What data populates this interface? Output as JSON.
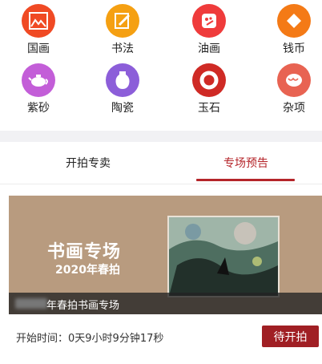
{
  "categories": [
    {
      "label": "国画",
      "icon": "landscape-painting-icon",
      "color": "#f04a24"
    },
    {
      "label": "书法",
      "icon": "calligraphy-brush-icon",
      "color": "#f5a012"
    },
    {
      "label": "油画",
      "icon": "oil-palette-icon",
      "color": "#ef3b3b"
    },
    {
      "label": "钱币",
      "icon": "coin-icon",
      "color": "#f47a16"
    },
    {
      "label": "紫砂",
      "icon": "teapot-icon",
      "color": "#c35ed8"
    },
    {
      "label": "陶瓷",
      "icon": "vase-icon",
      "color": "#8c5ed9"
    },
    {
      "label": "玉石",
      "icon": "jade-disc-icon",
      "color": "#cf2a25"
    },
    {
      "label": "杂项",
      "icon": "walnut-icon",
      "color": "#e86352"
    }
  ],
  "tabs": {
    "left": "开拍专卖",
    "right": "专场预告",
    "accent": "#b5252a"
  },
  "banner": {
    "title": "书画专场",
    "subtitle": "2020年春拍",
    "caption": "年春拍书画专场",
    "background": "#b89b7f"
  },
  "footer": {
    "start_time": "开始时间：0天9小时9分钟17秒",
    "status_button": "待开拍",
    "button_color": "#a01f24"
  }
}
